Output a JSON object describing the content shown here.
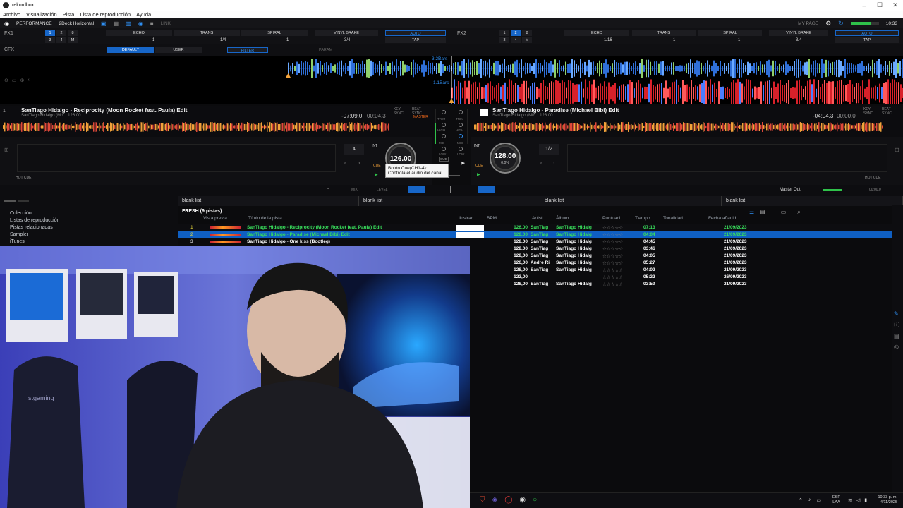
{
  "window": {
    "title": "rekordbox"
  },
  "menu": [
    "Archivo",
    "Visualización",
    "Pista",
    "Lista de reproducción",
    "Ayuda"
  ],
  "header": {
    "mode": "PERFORMANCE",
    "layout": "2Deck Horizontal",
    "link": "LINK",
    "my_page": "MY PAGE",
    "clock": "10:33"
  },
  "fx1": {
    "label": "FX1",
    "effects": [
      "ECHO",
      "TRANS",
      "SPIRAL",
      "VINYL BRAKE"
    ],
    "auto": "AUTO",
    "tap": "TAP",
    "beat_values": [
      "1",
      "1/4",
      "1",
      "3/4"
    ],
    "channels": [
      "1",
      "2",
      "8",
      "3",
      "4",
      "M"
    ]
  },
  "fx2": {
    "label": "FX2",
    "effects": [
      "ECHO",
      "TRANS",
      "SPIRAL",
      "VINYL BRAKE"
    ],
    "auto": "AUTO",
    "tap": "TAP",
    "beat_values": [
      "1/16",
      "1",
      "1",
      "3/4"
    ],
    "channels": [
      "1",
      "2",
      "8",
      "3",
      "4",
      "M"
    ]
  },
  "cfx": {
    "label": "CFX",
    "default": "DEFAULT",
    "user": "USER",
    "filter": "FILTER",
    "param": "PARAM"
  },
  "waveform": {
    "marker_top": "3.2Bars",
    "marker_bottom": "1.1Bars"
  },
  "deck1": {
    "title": "SanTiago Hidalgo - Reciprocity (Moon Rocket feat. Paula) Edit",
    "subtitle": "SanTiago Hidalgo (Mo...  126.00",
    "time_remaining": "-07:09.0",
    "time_elapsed": "00:04.3",
    "bpm": "126.00",
    "beat": "4",
    "int": "INT",
    "key_sync": "KEY SYNC",
    "beat_sync": "BEAT SYNC",
    "master": "MASTER",
    "hot_cue": "HOT CUE",
    "cue": "CUE"
  },
  "deck2": {
    "title": "SanTiago Hidalgo - Paradise (Michael Bibi) Edit",
    "subtitle": "SanTiago Hidalgo (Mic...  128.00",
    "time_remaining": "-04:04.3",
    "time_elapsed": "00:00.0",
    "bpm": "128.00",
    "pitch": "0.0%",
    "beat": "1/2",
    "int": "INT",
    "key_sync": "KEY SYNC",
    "beat_sync": "BEAT SYNC",
    "hot_cue": "HOT CUE",
    "cue": "CUE"
  },
  "mixer": {
    "trim": "TRIM",
    "high": "HIGH",
    "mid": "MID",
    "low": "LOW",
    "cue": "CUE"
  },
  "tooltip": {
    "line1": "Botón Cue(CH1-4):",
    "line2": "Controla el audio del canal."
  },
  "midbar": {
    "mix": "MIX",
    "level": "LEVEL",
    "master_out": "Master Out",
    "time": "00:00.0"
  },
  "tree": {
    "items": [
      "Colección",
      "Listas de reproducción",
      "Pistas relacionadas",
      "Sampler",
      "iTunes"
    ]
  },
  "playlist_tabs": [
    "blank list",
    "blank list",
    "blank list",
    "blank list"
  ],
  "table": {
    "folder": "FRESH (9 pistas)",
    "columns": [
      "Vista previa",
      "Título de la pista",
      "Ilustrac",
      "BPM",
      "Artist",
      "Álbum",
      "Puntuaci",
      "Tiempo",
      "Tonalidad",
      "Fecha añadid"
    ],
    "rows": [
      {
        "num": "1",
        "title": "SanTiago Hidalgo - Reciprocity (Moon Rocket feat. Paula) Edit",
        "bpm": "126,00",
        "artist": "SanTiag",
        "album": "SanTiago Hidalg",
        "rating": "☆☆☆☆☆",
        "time": "07:13",
        "date": "21/09/2023"
      },
      {
        "num": "2",
        "title": "SanTiago Hidalgo - Paradise (Michael Bibi) Edit",
        "bpm": "128,00",
        "artist": "SanTiag",
        "album": "SanTiago Hidalg",
        "rating": "☆☆☆☆☆",
        "time": "04:04",
        "date": "21/09/2023"
      },
      {
        "num": "3",
        "title": "SanTiago Hidalgo - One kiss (Bootleg)",
        "bpm": "128,00",
        "artist": "SanTiag",
        "album": "SanTiago Hidalg",
        "rating": "☆☆☆☆☆",
        "time": "04:45",
        "date": "21/09/2023"
      },
      {
        "num": "",
        "title": "",
        "bpm": "128,00",
        "artist": "SanTiag",
        "album": "SanTiago Hidalg",
        "rating": "☆☆☆☆☆",
        "time": "03:46",
        "date": "21/09/2023"
      },
      {
        "num": "",
        "title": "",
        "bpm": "128,00",
        "artist": "SanTiag",
        "album": "SanTiago Hidalg",
        "rating": "☆☆☆☆☆",
        "time": "04:05",
        "date": "21/09/2023"
      },
      {
        "num": "",
        "title": "",
        "bpm": "126,00",
        "artist": "Andre Ri",
        "album": "SanTiago Hidalg",
        "rating": "☆☆☆☆☆",
        "time": "05:27",
        "date": "21/09/2023"
      },
      {
        "num": "",
        "title": "",
        "bpm": "128,00",
        "artist": "SanTiag",
        "album": "SanTiago Hidalg",
        "rating": "☆☆☆☆☆",
        "time": "04:02",
        "date": "21/09/2023"
      },
      {
        "num": "",
        "title": "",
        "bpm": "123,00",
        "artist": "",
        "album": "",
        "rating": "☆☆☆☆☆",
        "time": "05:22",
        "date": "26/09/2023"
      },
      {
        "num": "",
        "title": "",
        "bpm": "128,00",
        "artist": "SanTiag",
        "album": "SanTiago Hidalg",
        "rating": "☆☆☆☆☆",
        "time": "03:59",
        "date": "21/09/2023"
      }
    ]
  },
  "taskbar": {
    "lang1": "ESP",
    "lang2": "LAA",
    "time": "10:33 p. m.",
    "date": "4/11/2025"
  },
  "webcam": {
    "chair_logo": "stgaming"
  }
}
